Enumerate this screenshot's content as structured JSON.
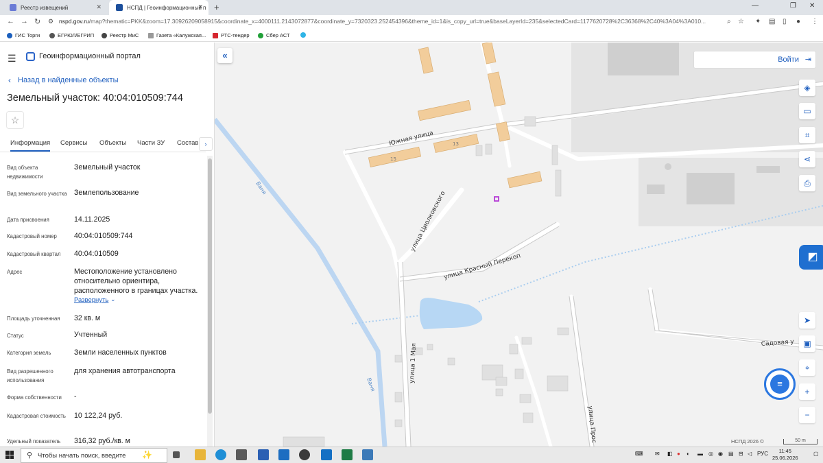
{
  "browser": {
    "tabs": [
      {
        "title": "Реестр извещений"
      },
      {
        "title": "НСПД | Геоинформационный п"
      }
    ],
    "url_main": "nspd.gov.ru",
    "url_rest": "/map?thematic=PKK&zoom=17.30926209058915&coordinate_x=4000111.2143072877&coordinate_y=7320323.252454396&theme_id=1&is_copy_url=true&baseLayerId=235&selectedCard=1177620728%2C36368%2C40%3A04%3A010...",
    "bookmarks": [
      "ГИС Торги",
      "ЕГРЮЛ/ЕГРИП",
      "Реестр МиС",
      "Газета «Калужская...",
      "РТС-тендер",
      "Сбер АСТ"
    ]
  },
  "portal": {
    "title": "Геоинформационный портал",
    "back_label": "Назад в найденные объекты",
    "parcel_title": "Земельный участок: 40:04:010509:744",
    "tabs": [
      "Информация",
      "Сервисы",
      "Объекты",
      "Части ЗУ",
      "Состав"
    ],
    "properties": [
      {
        "label": "Вид объекта недвижимости",
        "value": "Земельный участок"
      },
      {
        "label": "Вид земельного участка",
        "value": "Землепользование"
      },
      {
        "label": "Дата присвоения",
        "value": "14.11.2025"
      },
      {
        "label": "Кадастровый номер",
        "value": "40:04:010509:744"
      },
      {
        "label": "Кадастровый квартал",
        "value": "40:04:010509"
      },
      {
        "label": "Адрес",
        "value": "Местоположение установлено относительно ориентира, расположенного в границах участка."
      },
      {
        "label": "Площадь уточненная",
        "value": "32 кв. м"
      },
      {
        "label": "Статус",
        "value": "Учтенный"
      },
      {
        "label": "Категория земель",
        "value": "Земли населенных пунктов"
      },
      {
        "label": "Вид разрешенного использования",
        "value": "для хранения автотранспорта"
      },
      {
        "label": "Форма собственности",
        "value": "-"
      },
      {
        "label": "Кадастровая стоимость",
        "value": "10 122,24 руб."
      },
      {
        "label": "Удельный показатель",
        "value": "316,32 руб./кв. м"
      }
    ],
    "expand_label": "Развернуть"
  },
  "map": {
    "login_label": "Войти",
    "streets": [
      "Южная улица",
      "улица Циолковского",
      "улица Красный Перекоп",
      "улица 1 Мая",
      "Садовая у",
      "улица Прос",
      "Ваня",
      "Ваня"
    ],
    "house_numbers": [
      "15",
      "13"
    ],
    "copyright": "НСПД 2026 ©",
    "scale": "50 m"
  },
  "taskbar": {
    "search_placeholder": "Чтобы начать поиск, введите",
    "language": "РУС",
    "time": "11:45",
    "date": "25.06.2026"
  }
}
